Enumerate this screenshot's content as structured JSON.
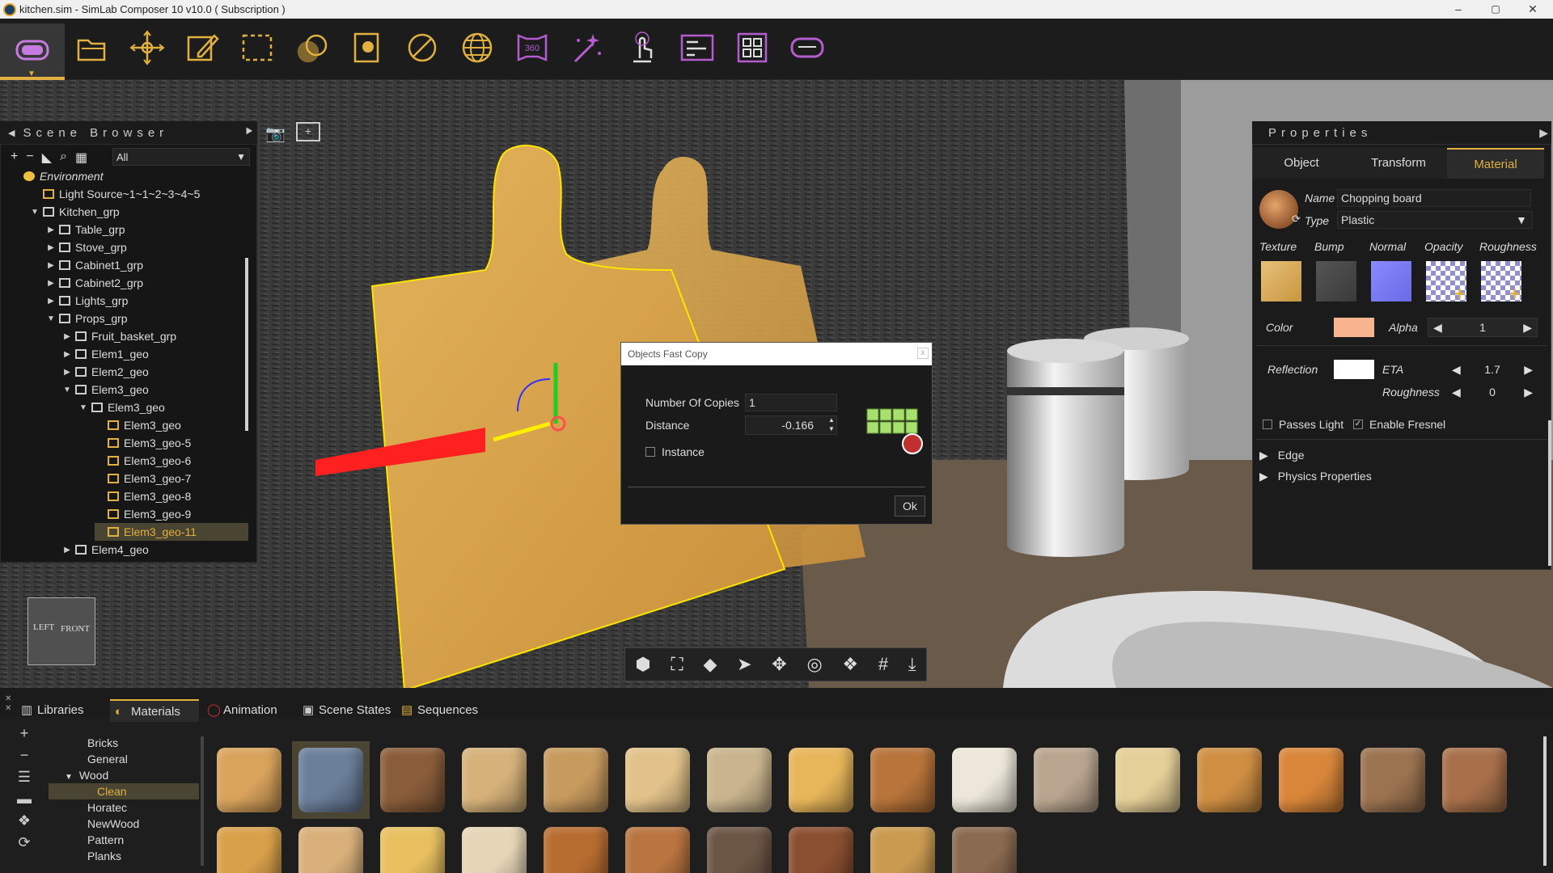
{
  "window": {
    "title": "kitchen.sim - SimLab Composer 10 v10.0 ( Subscription )",
    "minimize": "–",
    "maximize": "▢",
    "close": "✕"
  },
  "toolbar": {
    "icons": [
      "vr-headset-icon",
      "open-folder-icon",
      "move-icon",
      "edit-icon",
      "selection-icon",
      "materials-icon",
      "scene-icon",
      "no-icon",
      "globe-icon",
      "360-icon",
      "magic-icon",
      "touch-icon",
      "sequence-icon",
      "layout-icon",
      "vr-view-icon"
    ],
    "label_360": "360"
  },
  "scene_browser": {
    "title": "Scene Browser",
    "filter": "All",
    "tree": [
      {
        "label": "Environment",
        "indent": 0,
        "arrow": "",
        "icon": "sun"
      },
      {
        "label": "Light Source~1~1~2~3~4~5",
        "indent": 1,
        "arrow": "",
        "icon": "light"
      },
      {
        "label": "Kitchen_grp",
        "indent": 1,
        "arrow": "▼",
        "icon": "group"
      },
      {
        "label": "Table_grp",
        "indent": 2,
        "arrow": "▶",
        "icon": "group"
      },
      {
        "label": "Stove_grp",
        "indent": 2,
        "arrow": "▶",
        "icon": "group"
      },
      {
        "label": "Cabinet1_grp",
        "indent": 2,
        "arrow": "▶",
        "icon": "group"
      },
      {
        "label": "Cabinet2_grp",
        "indent": 2,
        "arrow": "▶",
        "icon": "group"
      },
      {
        "label": "Lights_grp",
        "indent": 2,
        "arrow": "▶",
        "icon": "group"
      },
      {
        "label": "Props_grp",
        "indent": 2,
        "arrow": "▼",
        "icon": "group"
      },
      {
        "label": "Fruit_basket_grp",
        "indent": 3,
        "arrow": "▶",
        "icon": "group"
      },
      {
        "label": "Elem1_geo",
        "indent": 3,
        "arrow": "▶",
        "icon": "group"
      },
      {
        "label": "Elem2_geo",
        "indent": 3,
        "arrow": "▶",
        "icon": "group"
      },
      {
        "label": "Elem3_geo",
        "indent": 3,
        "arrow": "▼",
        "icon": "group"
      },
      {
        "label": "Elem3_geo",
        "indent": 4,
        "arrow": "▼",
        "icon": "group"
      },
      {
        "label": "Elem3_geo",
        "indent": 5,
        "arrow": "",
        "icon": "mesh"
      },
      {
        "label": "Elem3_geo-5",
        "indent": 5,
        "arrow": "",
        "icon": "mesh"
      },
      {
        "label": "Elem3_geo-6",
        "indent": 5,
        "arrow": "",
        "icon": "mesh"
      },
      {
        "label": "Elem3_geo-7",
        "indent": 5,
        "arrow": "",
        "icon": "mesh"
      },
      {
        "label": "Elem3_geo-8",
        "indent": 5,
        "arrow": "",
        "icon": "mesh"
      },
      {
        "label": "Elem3_geo-9",
        "indent": 5,
        "arrow": "",
        "icon": "mesh"
      },
      {
        "label": "Elem3_geo-11",
        "indent": 5,
        "arrow": "",
        "icon": "mesh",
        "selected": true
      },
      {
        "label": "Elem4_geo",
        "indent": 3,
        "arrow": "▶",
        "icon": "group"
      }
    ]
  },
  "view_cube": {
    "left": "LEFT",
    "front": "FRONT"
  },
  "properties": {
    "title": "Properties",
    "tabs": [
      "Object",
      "Transform",
      "Material"
    ],
    "active_tab": "Material",
    "name_label": "Name",
    "name_value": "Chopping board",
    "type_label": "Type",
    "type_value": "Plastic",
    "map_labels": [
      "Texture",
      "Bump",
      "Normal",
      "Opacity",
      "Roughness"
    ],
    "color_label": "Color",
    "color_value": "#f8b48e",
    "alpha_label": "Alpha",
    "alpha_value": "1",
    "reflection_label": "Reflection",
    "eta_label": "ETA",
    "eta_value": "1.7",
    "roughness_label": "Roughness",
    "roughness_value": "0",
    "passes_light": "Passes Light",
    "passes_light_checked": false,
    "enable_fresnel": "Enable Fresnel",
    "enable_fresnel_checked": true,
    "sections": [
      "Edge",
      "Physics Properties"
    ]
  },
  "dialog": {
    "title": "Objects Fast Copy",
    "close": "x",
    "copies_label": "Number Of Copies",
    "copies_value": "1",
    "distance_label": "Distance",
    "distance_value": "-0.166",
    "instance_label": "Instance",
    "instance_checked": false,
    "ok": "Ok"
  },
  "bottom_tabs": [
    "Libraries",
    "Materials",
    "Animation",
    "Scene States",
    "Sequences"
  ],
  "active_bottom_tab": "Materials",
  "library_tree": [
    {
      "label": "Bricks",
      "indent": 1
    },
    {
      "label": "General",
      "indent": 1
    },
    {
      "label": "Wood",
      "indent": 0,
      "arrow": "▼"
    },
    {
      "label": "Clean",
      "indent": 1,
      "selected": true
    },
    {
      "label": "Horatec",
      "indent": 1
    },
    {
      "label": "NewWood",
      "indent": 1
    },
    {
      "label": "Pattern",
      "indent": 1
    },
    {
      "label": "Planks",
      "indent": 1
    }
  ],
  "swatches_row1": [
    "#d9a35c",
    "#6b7f9a",
    "#8a5d3a",
    "#d6b27a",
    "#c79a5e",
    "#e2c28a",
    "#c9b48d",
    "#e8b65a",
    "#b8743a",
    "#ece7da",
    "#b9a58f",
    "#e5cf98",
    "#cf8e42",
    "#d9863a",
    "#9b7350",
    "#a8704a"
  ],
  "swatches_row2": [
    "#d9a04a",
    "#d9b07a",
    "#e8c060",
    "#e6d6b8",
    "#b86d30",
    "#b97440",
    "#6b5545",
    "#8a4e30",
    "#c99a50",
    "#8a6a50"
  ]
}
